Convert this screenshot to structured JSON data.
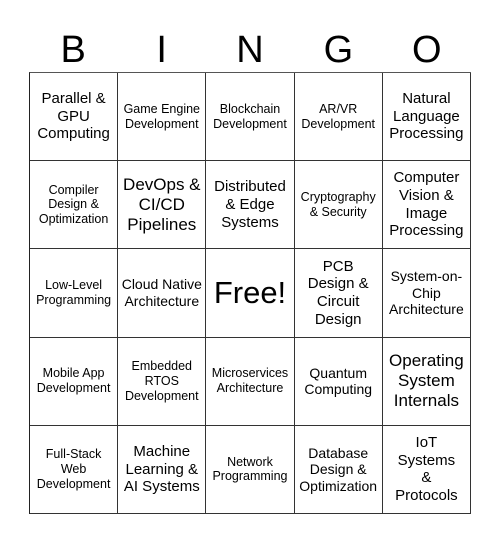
{
  "header": {
    "letters": [
      "B",
      "I",
      "N",
      "G",
      "O"
    ]
  },
  "grid": {
    "cells": [
      [
        "Parallel & GPU Computing",
        "Game Engine Development",
        "Blockchain Development",
        "AR/VR Development",
        "Natural Language Processing"
      ],
      [
        "Compiler Design & Optimization",
        "DevOps & CI/CD Pipelines",
        "Distributed & Edge Systems",
        "Cryptography & Security",
        "Computer Vision & Image Processing"
      ],
      [
        "Low-Level Programming",
        "Cloud Native Architecture",
        "Free!",
        "PCB Design & Circuit Design",
        "System-on-Chip Architecture"
      ],
      [
        "Mobile App Development",
        "Embedded RTOS Development",
        "Microservices Architecture",
        "Quantum Computing",
        "Operating System Internals"
      ],
      [
        "Full-Stack Web Development",
        "Machine Learning & AI Systems",
        "Network Programming",
        "Database Design & Optimization",
        "IoT Systems & Protocols"
      ]
    ]
  }
}
